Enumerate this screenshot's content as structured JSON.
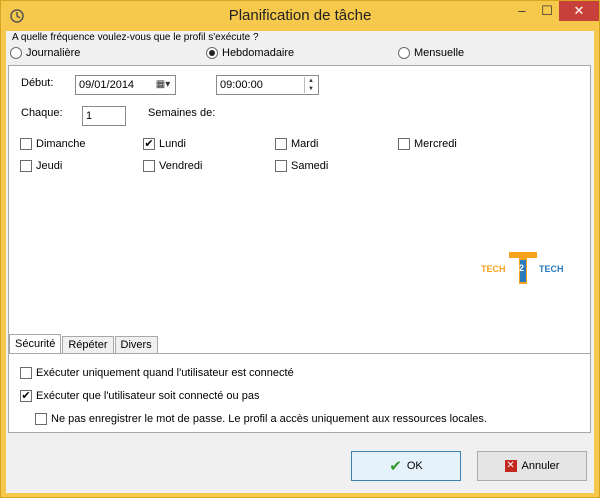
{
  "window": {
    "title": "Planification de tâche"
  },
  "question": "A quelle fréquence voulez-vous que le profil s'exécute ?",
  "frequency": [
    {
      "label": "Journalière",
      "selected": false
    },
    {
      "label": "Hebdomadaire",
      "selected": true
    },
    {
      "label": "Mensuelle",
      "selected": false
    }
  ],
  "schedule": {
    "debut_label": "Début:",
    "date_value": "09/01/2014",
    "time_value": "09:00:00",
    "chaque_label": "Chaque:",
    "chaque_value": "1",
    "semaines_label": "Semaines de:"
  },
  "days": [
    {
      "label": "Dimanche",
      "checked": false
    },
    {
      "label": "Lundi",
      "checked": true
    },
    {
      "label": "Mardi",
      "checked": false
    },
    {
      "label": "Mercredi",
      "checked": false
    },
    {
      "label": "Jeudi",
      "checked": false
    },
    {
      "label": "Vendredi",
      "checked": false
    },
    {
      "label": "Samedi",
      "checked": false
    }
  ],
  "logo": {
    "text_left": "TECH",
    "text_mid": "2",
    "text_right": "TECH"
  },
  "tabs": [
    "Sécurité",
    "Répéter",
    "Divers"
  ],
  "security": [
    {
      "label": "Exécuter uniquement quand l'utilisateur est connecté",
      "checked": false
    },
    {
      "label": "Exécuter que l'utilisateur soit connecté ou pas",
      "checked": true
    },
    {
      "label": "Ne pas enregistrer le mot de passe. Le profil a accès uniquement aux ressources locales.",
      "checked": false
    }
  ],
  "buttons": {
    "ok": "OK",
    "cancel": "Annuler"
  },
  "colors": {
    "title_bar": "#f6c84c",
    "close_button": "#c7403a",
    "ok_icon": "#2e9b26",
    "cancel_icon": "#c2281e",
    "logo_orange": "#f7a21b",
    "logo_blue": "#2b7bbf"
  }
}
